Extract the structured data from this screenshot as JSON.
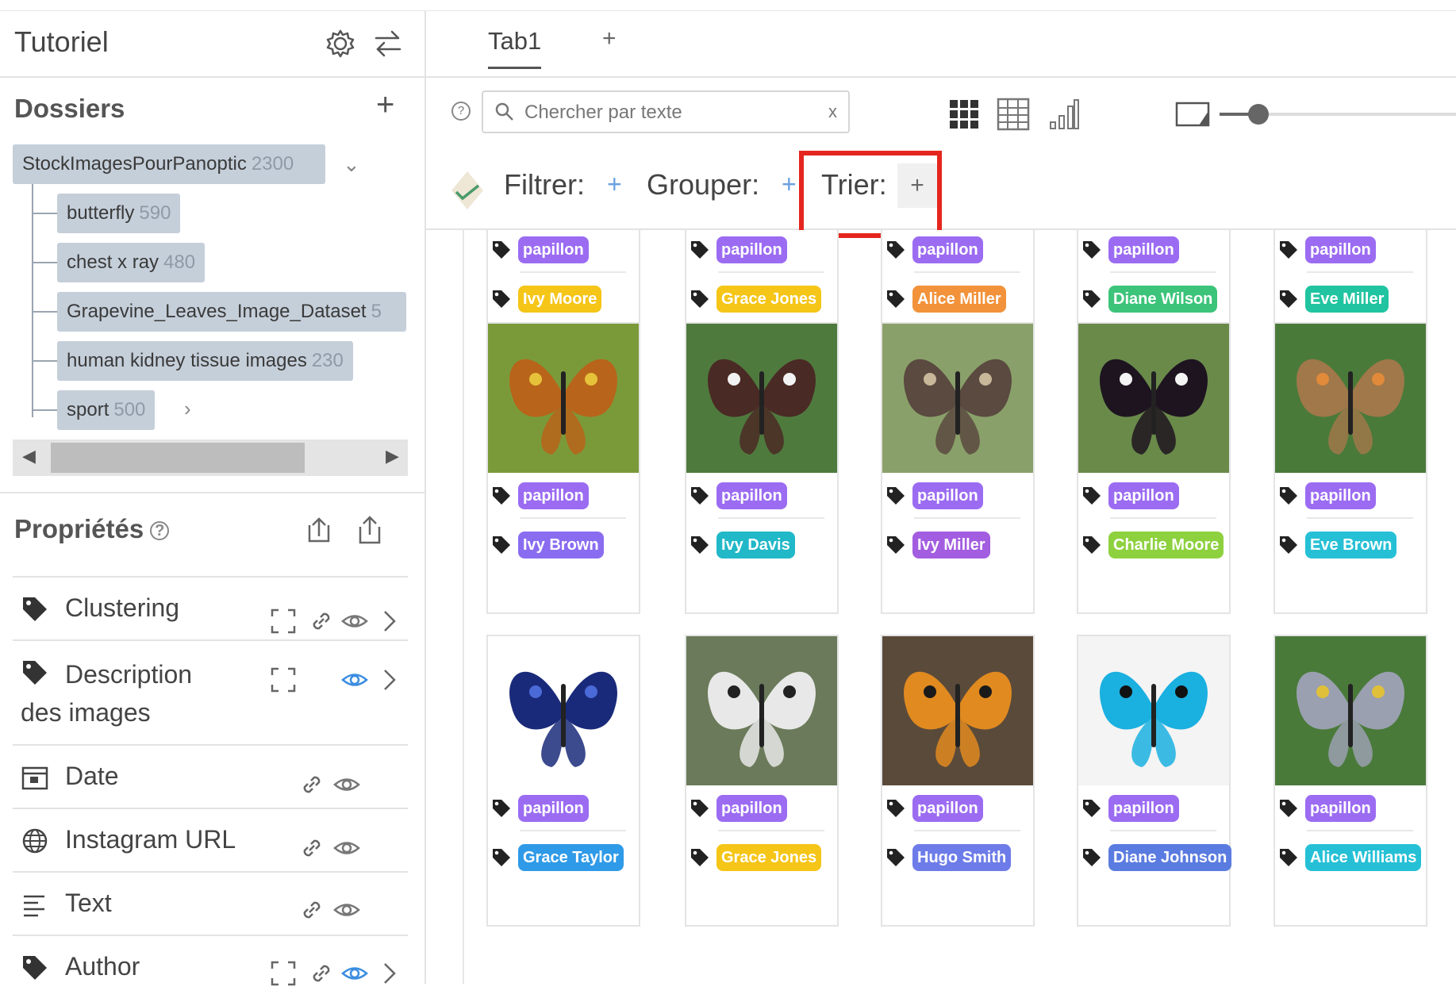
{
  "app": {
    "title": "Tutoriel"
  },
  "folders": {
    "title": "Dossiers",
    "root": {
      "label": "StockImagesPourPanoptic",
      "count": "2300"
    },
    "children": [
      {
        "label": "butterfly",
        "count": "590"
      },
      {
        "label": "chest x ray",
        "count": "480"
      },
      {
        "label": "Grapevine_Leaves_Image_Dataset",
        "count": "5"
      },
      {
        "label": "human kidney tissue images",
        "count": "230"
      },
      {
        "label": "sport",
        "count": "500"
      }
    ]
  },
  "properties": {
    "title": "Propriétés",
    "help": "?",
    "items": [
      {
        "label": "Clustering"
      },
      {
        "label": "Description des images"
      },
      {
        "label": "Date"
      },
      {
        "label": "Instagram URL"
      },
      {
        "label": "Text"
      },
      {
        "label": "Author"
      }
    ]
  },
  "tabs": [
    {
      "label": "Tab1"
    }
  ],
  "tab_add": "+",
  "search": {
    "placeholder": "Chercher par texte",
    "clear": "x"
  },
  "toolbar": {
    "filter_label": "Filtrer:",
    "group_label": "Grouper:",
    "sort_label": "Trier:",
    "add": "+"
  },
  "grid": {
    "rows": [
      [
        {
          "tag": "papillon",
          "author": "Ivy Moore",
          "author_color": "#f5c518"
        },
        {
          "tag": "papillon",
          "author": "Grace Jones",
          "author_color": "#f5c518"
        },
        {
          "tag": "papillon",
          "author": "Alice Miller",
          "author_color": "#f2923a"
        },
        {
          "tag": "papillon",
          "author": "Diane Wilson",
          "author_color": "#3cc47a"
        },
        {
          "tag": "papillon",
          "author": "Eve Miller",
          "author_color": "#21c4a0"
        }
      ],
      [
        {
          "tag": "papillon",
          "author": "Ivy Brown",
          "author_color": "#8a6cf0"
        },
        {
          "tag": "papillon",
          "author": "Ivy Davis",
          "author_color": "#21b8c8"
        },
        {
          "tag": "papillon",
          "author": "Ivy Miller",
          "author_color": "#a35de0"
        },
        {
          "tag": "papillon",
          "author": "Charlie Moore",
          "author_color": "#8ed13f"
        },
        {
          "tag": "papillon",
          "author": "Eve Brown",
          "author_color": "#26c0d6"
        }
      ],
      [
        {
          "tag": "papillon",
          "author": "Grace Taylor",
          "author_color": "#2f9ae8"
        },
        {
          "tag": "papillon",
          "author": "Grace Jones",
          "author_color": "#f5c518"
        },
        {
          "tag": "papillon",
          "author": "Hugo Smith",
          "author_color": "#6d7ce8"
        },
        {
          "tag": "papillon",
          "author": "Diane Johnson",
          "author_color": "#5a7be0"
        },
        {
          "tag": "papillon",
          "author": "Alice Williams",
          "author_color": "#26c0d6"
        }
      ]
    ]
  },
  "colors": {
    "tag_purple": "#9b6cf2",
    "highlight": "#e5261e",
    "folder_bg": "#c5cfda",
    "accent_eye": "#3b8de0"
  }
}
